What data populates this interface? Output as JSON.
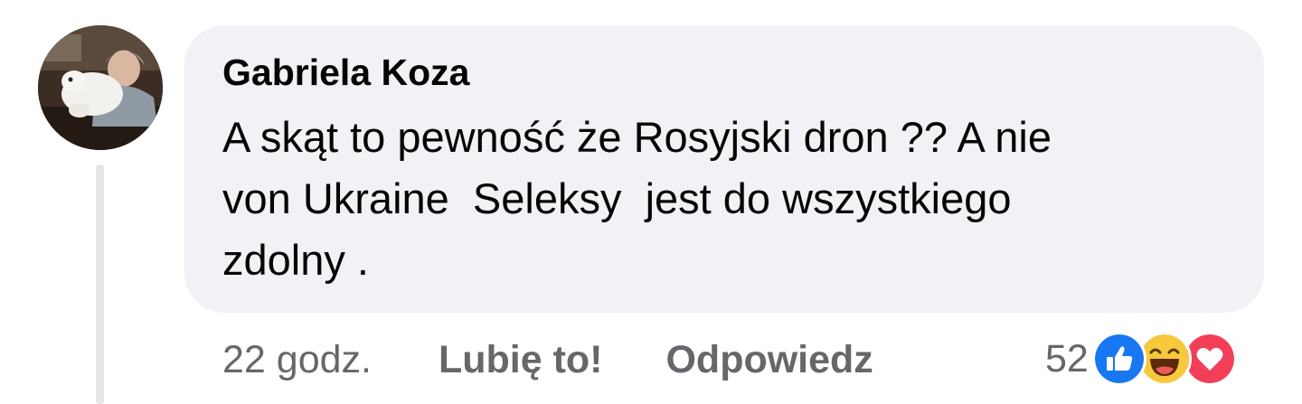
{
  "comment": {
    "author": "Gabriela Koza",
    "text": "A skąt to pewność że Rosyjski dron ?? A nie\nvon Ukraine  Seleksy  jest do wszystkiego\nzdolny ."
  },
  "actions": {
    "time": "22 godz.",
    "like_label": "Lubię to!",
    "reply_label": "Odpowiedz"
  },
  "reactions": {
    "count": "52",
    "icons": [
      "like-reaction-icon",
      "haha-reaction-icon",
      "love-reaction-icon"
    ]
  },
  "colors": {
    "bubble_bg": "#f0f2f5",
    "text": "#050505",
    "secondary_text": "#65676b",
    "like_blue": "#1877f2",
    "haha_yellow": "#f7c83b",
    "love_red": "#f33e58",
    "thread_line": "#e4e6ea"
  }
}
